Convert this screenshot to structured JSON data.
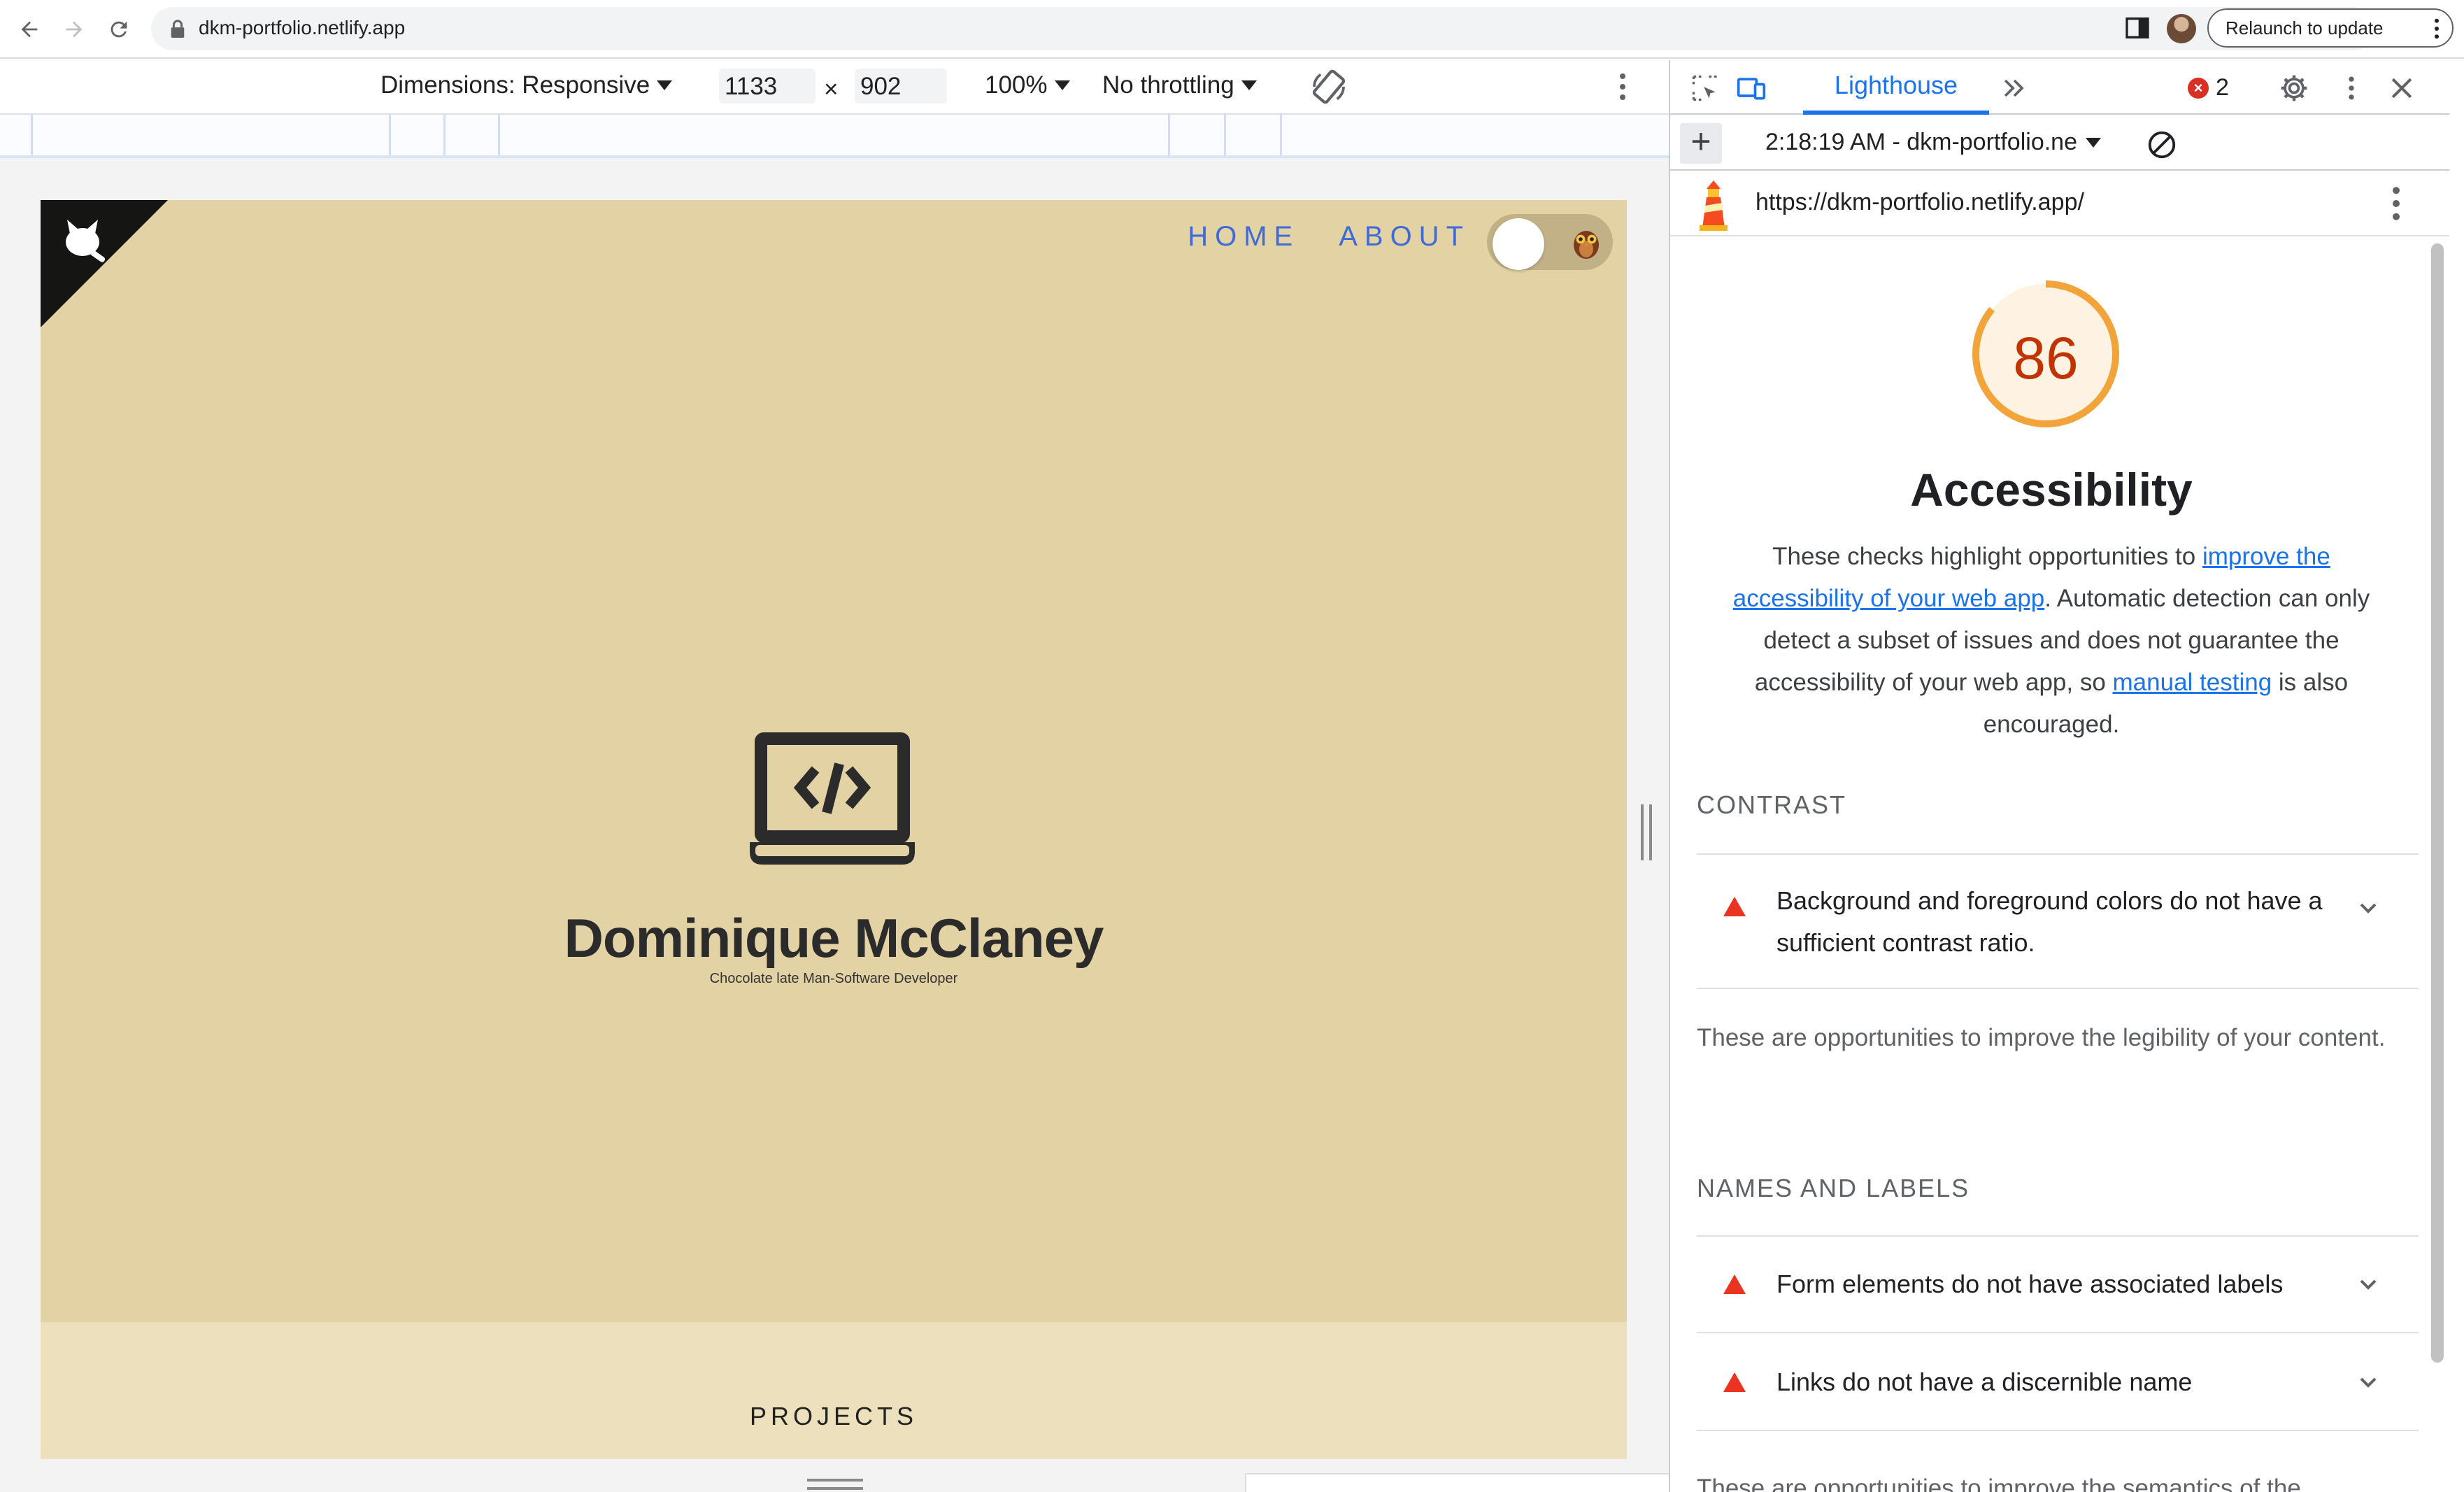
{
  "browser": {
    "url": "dkm-portfolio.netlify.app",
    "relaunch_label": "Relaunch to update"
  },
  "device_toolbar": {
    "dimensions_label": "Dimensions: Responsive",
    "width": "1133",
    "times": "×",
    "height": "902",
    "zoom": "100%",
    "throttling": "No throttling"
  },
  "site": {
    "nav": [
      "HOME",
      "ABOUT"
    ],
    "name": "Dominique McClaney",
    "tagline": "Chocolate late Man-Software Developer",
    "projects_heading": "PROJECTS"
  },
  "devtools": {
    "tab_label": "Lighthouse",
    "error_count": "2",
    "report_select": "2:18:19 AM - dkm-portfolio.ne",
    "report_url": "https://dkm-portfolio.netlify.app/",
    "score": "86",
    "score_fraction": 0.86,
    "category_title": "Accessibility",
    "desc_1": "These checks highlight opportunities to ",
    "desc_link_1": "improve the accessibility of your web app",
    "desc_2": ". Automatic detection can only detect a subset of issues and does not guarantee the accessibility of your web app, so ",
    "desc_link_2": "manual testing",
    "desc_3": " is also encouraged.",
    "groups": {
      "contrast": {
        "title": "CONTRAST",
        "audit": "Background and foreground colors do not have a sufficient contrast ratio.",
        "description": "These are opportunities to improve the legibility of your content."
      },
      "names_labels": {
        "title": "NAMES AND LABELS",
        "audit_1": "Form elements do not have associated labels",
        "audit_2": "Links do not have a discernible name",
        "partial": "These are opportunities to improve the semantics of the"
      }
    }
  },
  "colors": {
    "page_bg": "#e3d3a4",
    "nav_link": "#3f6bd8",
    "score_orange": "#f2a43a",
    "score_text": "#c33300",
    "fail_red": "#eb3322",
    "link_blue": "#1a73e8"
  }
}
